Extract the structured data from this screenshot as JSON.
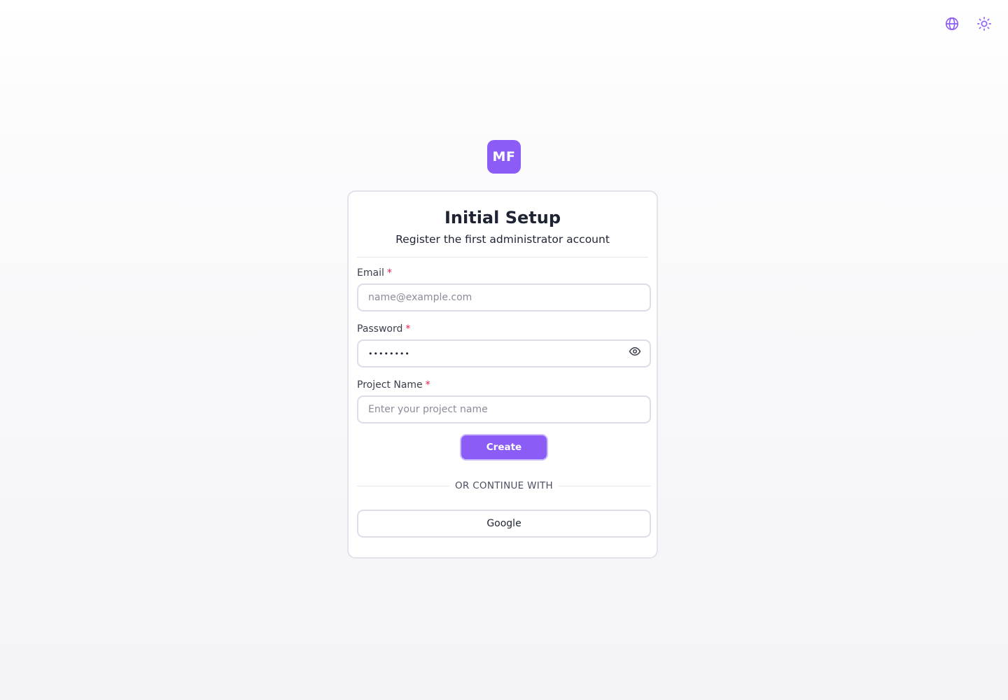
{
  "header": {
    "icons": [
      "globe-icon",
      "sun-icon"
    ]
  },
  "logo": {
    "text": "MF",
    "color": "#8b5cf6"
  },
  "card": {
    "title": "Initial Setup",
    "subtitle": "Register the first administrator account"
  },
  "form": {
    "email": {
      "label": "Email",
      "required_mark": "*",
      "placeholder": "name@example.com",
      "value": ""
    },
    "password": {
      "label": "Password",
      "required_mark": "*",
      "value": "••••••••",
      "toggle_icon": "eye-icon"
    },
    "project_name": {
      "label": "Project Name",
      "required_mark": "*",
      "placeholder": "Enter your project name",
      "value": ""
    },
    "submit_label": "Create"
  },
  "divider_text": "OR CONTINUE WITH",
  "oauth": {
    "google_label": "Google"
  },
  "colors": {
    "accent": "#8b5cf6",
    "required": "#e11d48",
    "text": "#1e2433"
  }
}
